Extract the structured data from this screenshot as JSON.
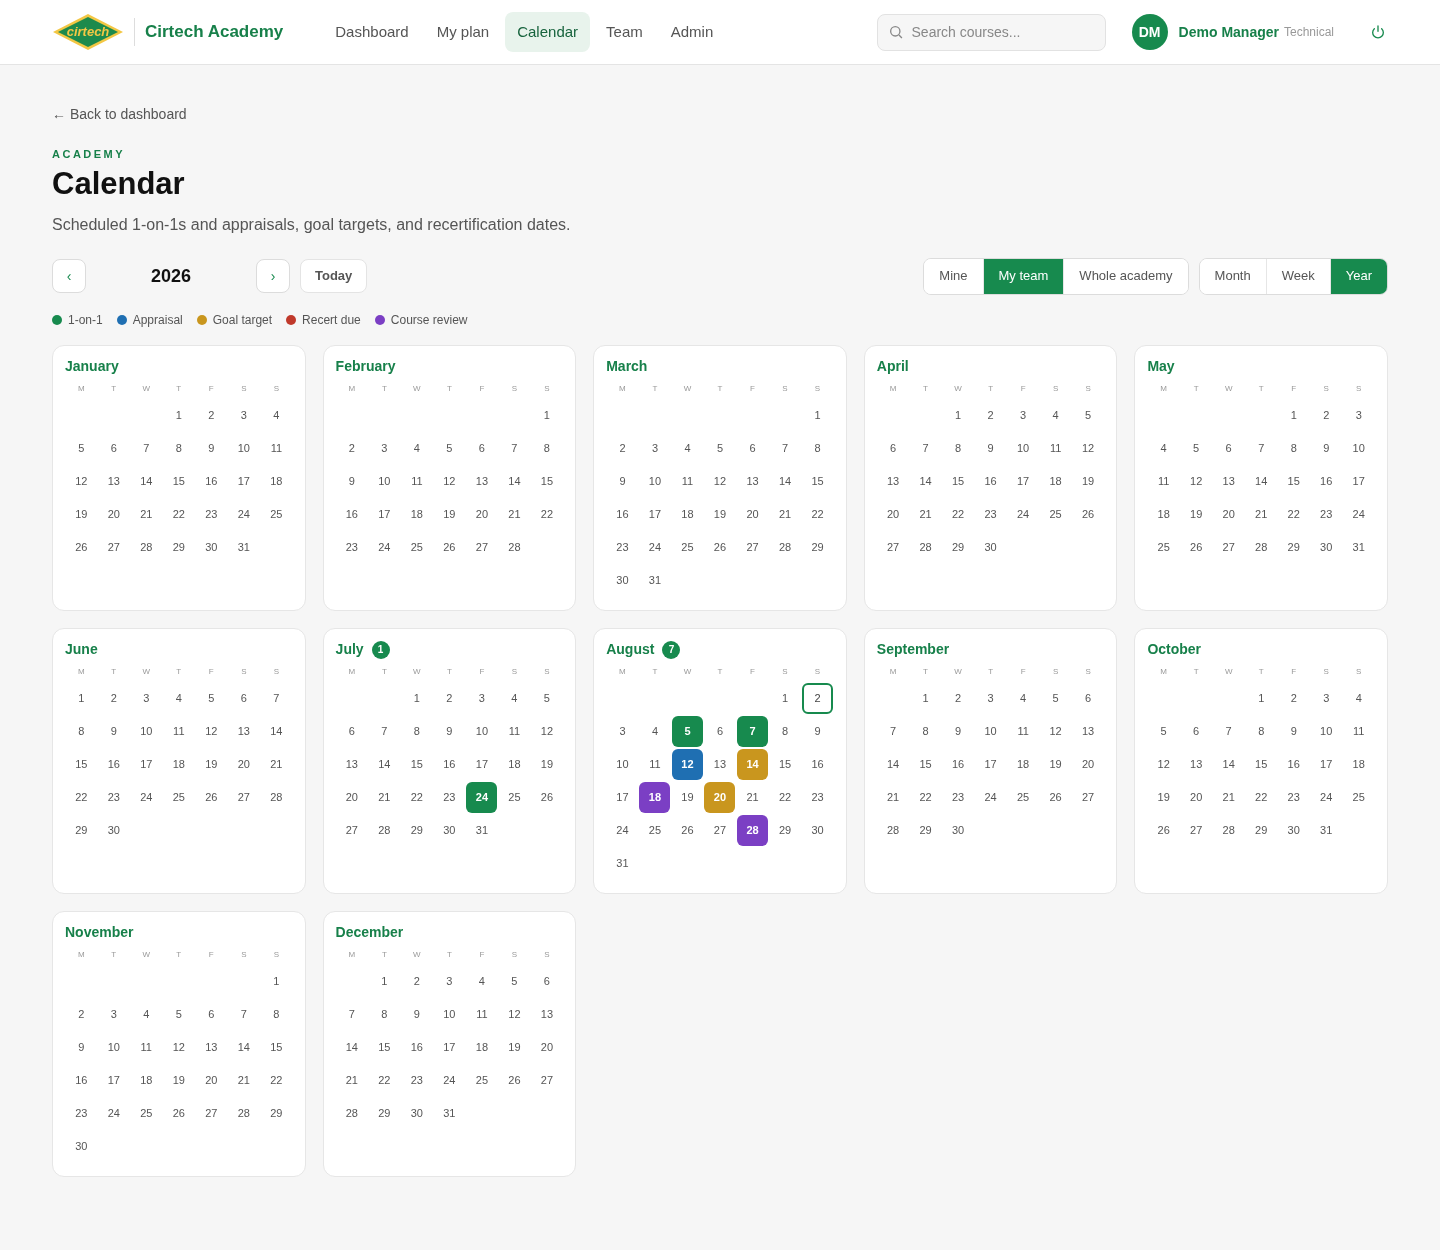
{
  "header": {
    "logo_text": "cirtech",
    "brand": "Cirtech Academy",
    "nav": [
      {
        "label": "Dashboard",
        "selected": false
      },
      {
        "label": "My plan",
        "selected": false
      },
      {
        "label": "Calendar",
        "selected": true
      },
      {
        "label": "Team",
        "selected": false
      },
      {
        "label": "Admin",
        "selected": false
      }
    ],
    "search": {
      "placeholder": "Search courses..."
    },
    "user": {
      "initials": "DM",
      "name": "Demo Manager",
      "role": "Technical"
    }
  },
  "back_link": "← Back to dashboard",
  "eyebrow": "ACADEMY",
  "title": "Calendar",
  "subtitle": "Scheduled 1-on-1s and appraisals, goal targets, and recertification dates.",
  "toolbar": {
    "prev": "‹",
    "year": "2026",
    "next": "›",
    "today": "Today",
    "scope": [
      {
        "label": "Mine",
        "selected": false
      },
      {
        "label": "My team",
        "selected": true
      },
      {
        "label": "Whole academy",
        "selected": false
      }
    ],
    "views": [
      {
        "label": "Month",
        "selected": false
      },
      {
        "label": "Week",
        "selected": false
      },
      {
        "label": "Year",
        "selected": true
      }
    ]
  },
  "legend": [
    {
      "label": "1-on-1",
      "color": "#178a4e"
    },
    {
      "label": "Appraisal",
      "color": "#1f6fb2"
    },
    {
      "label": "Goal target",
      "color": "#c9961e"
    },
    {
      "label": "Recert due",
      "color": "#c0392b"
    },
    {
      "label": "Course review",
      "color": "#7b3fc4"
    }
  ],
  "months": [
    {
      "name": "January",
      "weekdays": [
        "M",
        "T",
        "W",
        "T",
        "F",
        "S",
        "S"
      ],
      "weeks": [
        [
          "1",
          "2",
          "3",
          "4"
        ],
        [
          "5",
          "6",
          "7",
          "8",
          "9",
          "10",
          "11"
        ],
        [
          "12",
          "13",
          "14",
          "15",
          "16",
          "17",
          "18"
        ],
        [
          "19",
          "20",
          "21",
          "22",
          "23",
          "24",
          "25"
        ],
        [
          "26",
          "27",
          "28",
          "29",
          "30",
          "31"
        ]
      ]
    },
    {
      "name": "February",
      "weekdays": [
        "M",
        "T",
        "W",
        "T",
        "F",
        "S",
        "S"
      ],
      "weeks": [
        [
          "1"
        ],
        [
          "2",
          "3",
          "4",
          "5",
          "6",
          "7",
          "8"
        ],
        [
          "9",
          "10",
          "11",
          "12",
          "13",
          "14",
          "15"
        ],
        [
          "16",
          "17",
          "18",
          "19",
          "20",
          "21",
          "22"
        ],
        [
          "23",
          "24",
          "25",
          "26",
          "27",
          "28"
        ]
      ]
    },
    {
      "name": "March",
      "weekdays": [
        "M",
        "T",
        "W",
        "T",
        "F",
        "S",
        "S"
      ],
      "weeks": [
        [
          "1"
        ],
        [
          "2",
          "3",
          "4",
          "5",
          "6",
          "7",
          "8"
        ],
        [
          "9",
          "10",
          "11",
          "12",
          "13",
          "14",
          "15"
        ],
        [
          "16",
          "17",
          "18",
          "19",
          "20",
          "21",
          "22"
        ],
        [
          "23",
          "24",
          "25",
          "26",
          "27",
          "28",
          "29"
        ],
        [
          "30",
          "31"
        ]
      ]
    },
    {
      "name": "April",
      "weekdays": [
        "M",
        "T",
        "W",
        "T",
        "F",
        "S",
        "S"
      ],
      "weeks": [
        [
          "1",
          "2",
          "3",
          "4",
          "5"
        ],
        [
          "6",
          "7",
          "8",
          "9",
          "10",
          "11",
          "12"
        ],
        [
          "13",
          "14",
          "15",
          "16",
          "17",
          "18",
          "19"
        ],
        [
          "20",
          "21",
          "22",
          "23",
          "24",
          "25",
          "26"
        ],
        [
          "27",
          "28",
          "29",
          "30"
        ]
      ]
    },
    {
      "name": "May",
      "weekdays": [
        "M",
        "T",
        "W",
        "T",
        "F",
        "S",
        "S"
      ],
      "weeks": [
        [
          "1",
          "2",
          "3"
        ],
        [
          "4",
          "5",
          "6",
          "7",
          "8",
          "9",
          "10"
        ],
        [
          "11",
          "12",
          "13",
          "14",
          "15",
          "16",
          "17"
        ],
        [
          "18",
          "19",
          "20",
          "21",
          "22",
          "23",
          "24"
        ],
        [
          "25",
          "26",
          "27",
          "28",
          "29",
          "30",
          "31"
        ]
      ]
    },
    {
      "name": "June",
      "weekdays": [
        "M",
        "T",
        "W",
        "T",
        "F",
        "S",
        "S"
      ],
      "weeks": [
        [
          "1",
          "2",
          "3",
          "4",
          "5",
          "6",
          "7"
        ],
        [
          "8",
          "9",
          "10",
          "11",
          "12",
          "13",
          "14"
        ],
        [
          "15",
          "16",
          "17",
          "18",
          "19",
          "20",
          "21"
        ],
        [
          "22",
          "23",
          "24",
          "25",
          "26",
          "27",
          "28"
        ],
        [
          "29",
          "30"
        ]
      ]
    },
    {
      "name": "July",
      "badge": "1",
      "weekdays": [
        "M",
        "T",
        "W",
        "T",
        "F",
        "S",
        "S"
      ],
      "weeks": [
        [
          "1",
          "2",
          "3",
          "4",
          "5"
        ],
        [
          "6",
          "7",
          "8",
          "9",
          "10",
          "11",
          "12"
        ],
        [
          "13",
          "14",
          "15",
          "16",
          "17",
          "18",
          "19"
        ],
        [
          "20",
          "21",
          "22",
          "23",
          {
            "day": "24",
            "color": "#178a4e"
          },
          "25",
          "26"
        ],
        [
          "27",
          "28",
          "29",
          "30",
          "31"
        ]
      ]
    },
    {
      "name": "August",
      "badge": "7",
      "weekdays": [
        "M",
        "T",
        "W",
        "T",
        "F",
        "S",
        "S"
      ],
      "weeks": [
        [
          "1",
          {
            "day": "2",
            "today": true
          }
        ],
        [
          "3",
          "4",
          {
            "day": "5",
            "color": "#178a4e"
          },
          "6",
          {
            "day": "7",
            "color": "#178a4e"
          },
          "8",
          "9"
        ],
        [
          "10",
          "11",
          {
            "day": "12",
            "color": "#1f6fb2"
          },
          "13",
          {
            "day": "14",
            "color": "#c9961e"
          },
          "15",
          "16"
        ],
        [
          "17",
          {
            "day": "18",
            "color": "#7b3fc4"
          },
          "19",
          {
            "day": "20",
            "color": "#c9961e"
          },
          "21",
          "22",
          "23"
        ],
        [
          "24",
          "25",
          "26",
          "27",
          {
            "day": "28",
            "color": "#7b3fc4"
          },
          "29",
          "30"
        ],
        [
          "31"
        ]
      ]
    },
    {
      "name": "September",
      "weekdays": [
        "M",
        "T",
        "W",
        "T",
        "F",
        "S",
        "S"
      ],
      "weeks": [
        [
          "1",
          "2",
          "3",
          "4",
          "5",
          "6"
        ],
        [
          "7",
          "8",
          "9",
          "10",
          "11",
          "12",
          "13"
        ],
        [
          "14",
          "15",
          "16",
          "17",
          "18",
          "19",
          "20"
        ],
        [
          "21",
          "22",
          "23",
          "24",
          "25",
          "26",
          "27"
        ],
        [
          "28",
          "29",
          "30"
        ]
      ]
    },
    {
      "name": "October",
      "weekdays": [
        "M",
        "T",
        "W",
        "T",
        "F",
        "S",
        "S"
      ],
      "weeks": [
        [
          "1",
          "2",
          "3",
          "4"
        ],
        [
          "5",
          "6",
          "7",
          "8",
          "9",
          "10",
          "11"
        ],
        [
          "12",
          "13",
          "14",
          "15",
          "16",
          "17",
          "18"
        ],
        [
          "19",
          "20",
          "21",
          "22",
          "23",
          "24",
          "25"
        ],
        [
          "26",
          "27",
          "28",
          "29",
          "30",
          "31"
        ]
      ]
    },
    {
      "name": "November",
      "weekdays": [
        "M",
        "T",
        "W",
        "T",
        "F",
        "S",
        "S"
      ],
      "weeks": [
        [
          "1"
        ],
        [
          "2",
          "3",
          "4",
          "5",
          "6",
          "7",
          "8"
        ],
        [
          "9",
          "10",
          "11",
          "12",
          "13",
          "14",
          "15"
        ],
        [
          "16",
          "17",
          "18",
          "19",
          "20",
          "21",
          "22"
        ],
        [
          "23",
          "24",
          "25",
          "26",
          "27",
          "28",
          "29"
        ],
        [
          "30"
        ]
      ]
    },
    {
      "name": "December",
      "weekdays": [
        "M",
        "T",
        "W",
        "T",
        "F",
        "S",
        "S"
      ],
      "weeks": [
        [
          "1",
          "2",
          "3",
          "4",
          "5",
          "6"
        ],
        [
          "7",
          "8",
          "9",
          "10",
          "11",
          "12",
          "13"
        ],
        [
          "14",
          "15",
          "16",
          "17",
          "18",
          "19",
          "20"
        ],
        [
          "21",
          "22",
          "23",
          "24",
          "25",
          "26",
          "27"
        ],
        [
          "28",
          "29",
          "30",
          "31"
        ]
      ]
    }
  ]
}
